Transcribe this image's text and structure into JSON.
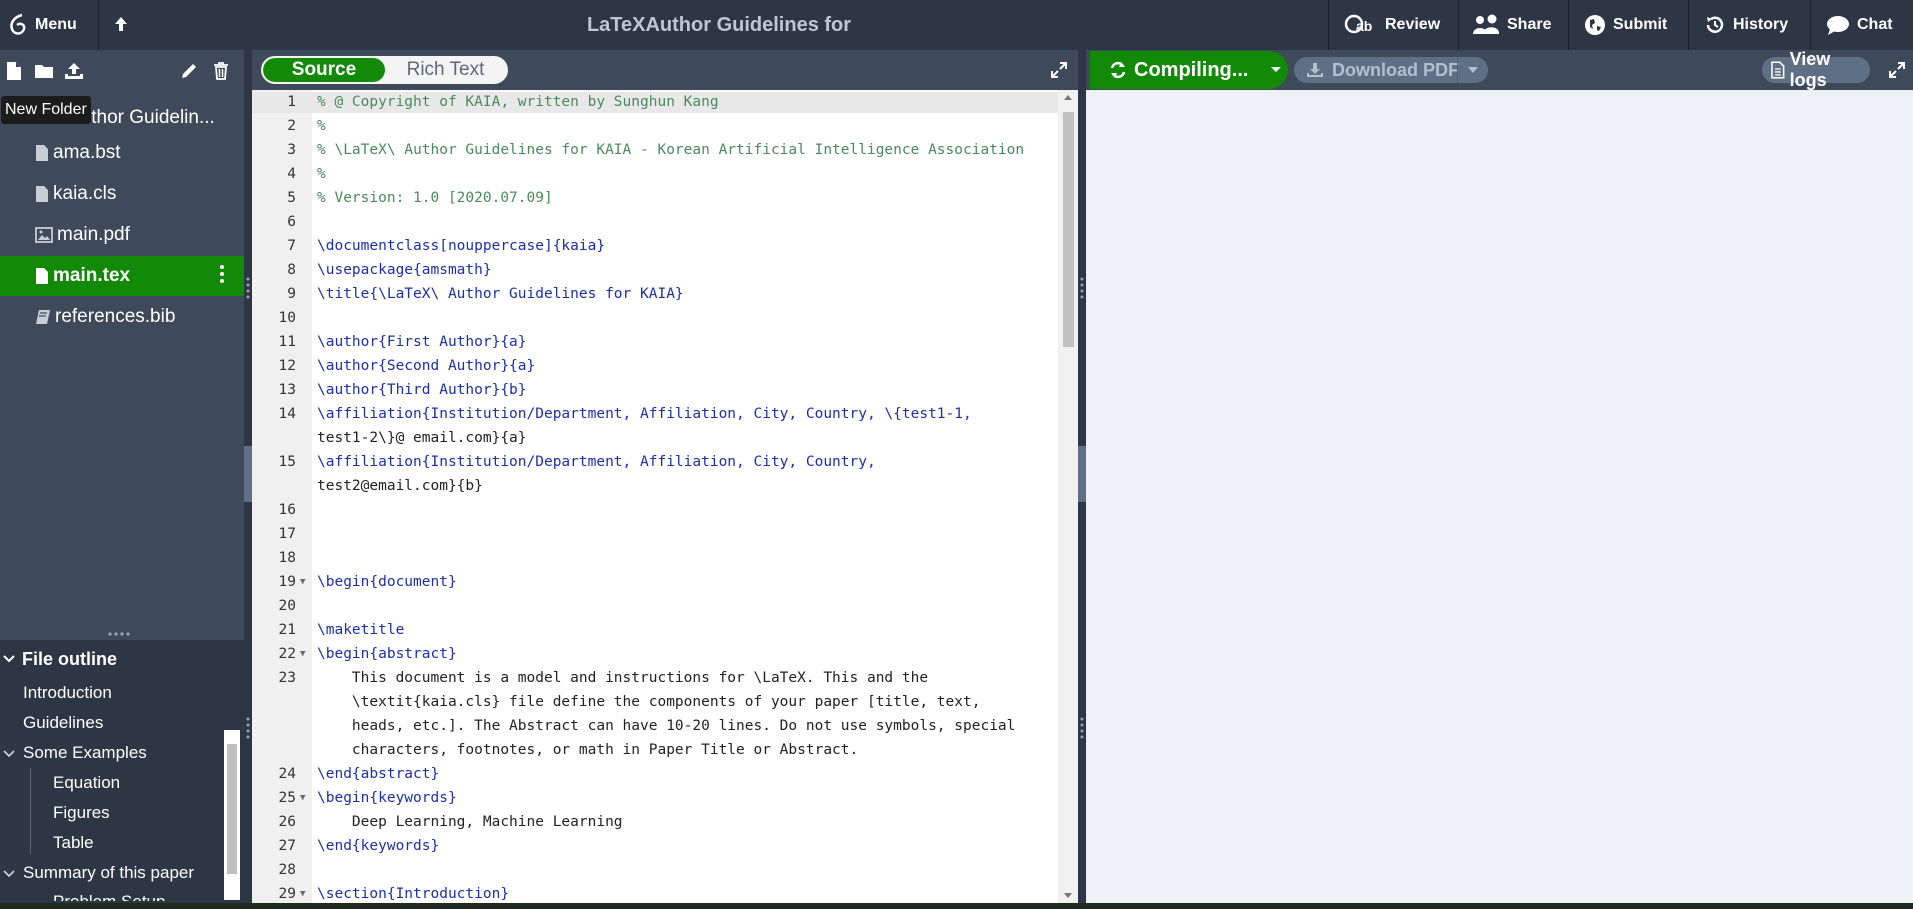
{
  "topbar": {
    "menu_label": "Menu",
    "title": "LaTeXAuthor Guidelines for KAIA",
    "review_label": "Review",
    "share_label": "Share",
    "submit_label": "Submit",
    "history_label": "History",
    "chat_label": "Chat"
  },
  "sidebar": {
    "tooltip": "New Folder",
    "root_label": "Author Guidelin...",
    "files": [
      {
        "name": "ama.bst"
      },
      {
        "name": "kaia.cls"
      },
      {
        "name": "main.pdf"
      },
      {
        "name": "main.tex",
        "selected": true
      },
      {
        "name": "references.bib"
      }
    ],
    "outline_title": "File outline",
    "outline_items": [
      "Introduction",
      "Guidelines",
      "Some Examples",
      "Equation",
      "Figures",
      "Table",
      "Summary of this paper",
      "Problem Setup"
    ]
  },
  "editor": {
    "source_label": "Source",
    "rich_text_label": "Rich Text",
    "line_numbers": [
      "1",
      "2",
      "3",
      "4",
      "5",
      "6",
      "7",
      "8",
      "9",
      "10",
      "11",
      "12",
      "13",
      "14",
      "",
      "15",
      "",
      "16",
      "17",
      "18",
      "19",
      "20",
      "21",
      "22",
      "23",
      "",
      "",
      "",
      "24",
      "25",
      "26",
      "27",
      "28",
      "29"
    ],
    "lines": {
      "l1": "% @ Copyright of KAIA, written by Sunghun Kang",
      "l2": "%",
      "l3": "% \\LaTeX\\ Author Guidelines for KAIA - Korean Artificial Intelligence Association",
      "l4": "%",
      "l5": "% Version: 1.0 [2020.07.09]",
      "l7": "\\documentclass[nouppercase]{kaia}",
      "l8": "\\usepackage{amsmath}",
      "l9": "\\title{\\LaTeX\\ Author Guidelines for KAIA}",
      "l11": "\\author{First Author}{a}",
      "l12": "\\author{Second Author}{a}",
      "l13": "\\author{Third Author}{b}",
      "l14a": "\\affiliation{Institution/Department, Affiliation, City, Country, \\{test1-1,",
      "l14b": "test1-2\\}@ email.com}{a}",
      "l15a": "\\affiliation{Institution/Department, Affiliation, City, Country,",
      "l15b": "test2@email.com}{b}",
      "l19": "\\begin{document}",
      "l21": "\\maketitle",
      "l22": "\\begin{abstract}",
      "l23a": "    This document is a model and instructions for \\LaTeX. This and the",
      "l23b": "    \\textit{kaia.cls} file define the components of your paper [title, text,",
      "l23c": "    heads, etc.]. The Abstract can have 10-20 lines. Do not use symbols, special",
      "l23d": "    characters, footnotes, or math in Paper Title or Abstract.",
      "l24": "\\end{abstract}",
      "l25": "\\begin{keywords}",
      "l26": "    Deep Learning, Machine Learning",
      "l27": "\\end{keywords}",
      "l29": "\\section{Introduction}"
    }
  },
  "pdf": {
    "compile_label": "Compiling...",
    "download_label": "Download PDF",
    "logs_label": "View logs"
  },
  "colors": {
    "topbar_bg": "#2c3645",
    "sidebar_bg": "#3e4a5a",
    "accent_green": "#138a07",
    "comment_green": "#4a8a5c",
    "command_blue": "#1b30a8",
    "spell_red": "#e0413f"
  },
  "icons": [
    "overleaf-logo-icon",
    "upload-arrow-icon",
    "review-icon",
    "share-icon",
    "globe-icon",
    "history-icon",
    "chat-icon",
    "new-file-icon",
    "new-folder-icon",
    "upload-icon",
    "pencil-icon",
    "trash-icon",
    "file-icon",
    "image-file-icon",
    "book-icon",
    "kebab-icon",
    "chevron-down-icon",
    "expand-icon",
    "refresh-icon",
    "download-icon",
    "file-text-icon"
  ]
}
